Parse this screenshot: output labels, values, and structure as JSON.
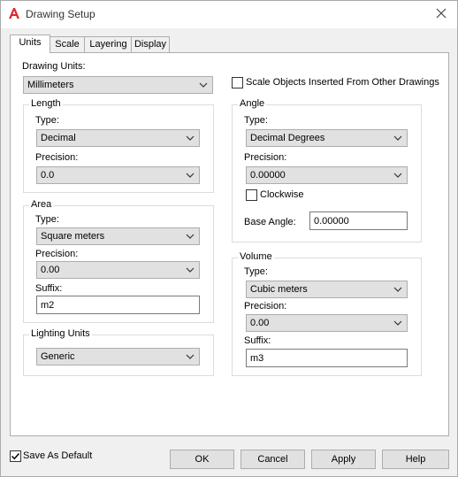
{
  "window": {
    "title": "Drawing Setup",
    "app_icon": "autocad-a-icon",
    "close_icon": "close-icon"
  },
  "tabs": [
    {
      "label": "Units",
      "active": true
    },
    {
      "label": "Scale",
      "active": false
    },
    {
      "label": "Layering",
      "active": false
    },
    {
      "label": "Display",
      "active": false
    }
  ],
  "units": {
    "drawing_units_label": "Drawing Units:",
    "drawing_units_value": "Millimeters",
    "scale_objects_label": "Scale Objects Inserted From Other Drawings",
    "scale_objects_checked": false,
    "length": {
      "title": "Length",
      "type_label": "Type:",
      "type_value": "Decimal",
      "precision_label": "Precision:",
      "precision_value": "0.0"
    },
    "area": {
      "title": "Area",
      "type_label": "Type:",
      "type_value": "Square meters",
      "precision_label": "Precision:",
      "precision_value": "0.00",
      "suffix_label": "Suffix:",
      "suffix_value": "m2"
    },
    "lighting": {
      "title": "Lighting Units",
      "value": "Generic"
    },
    "angle": {
      "title": "Angle",
      "type_label": "Type:",
      "type_value": "Decimal Degrees",
      "precision_label": "Precision:",
      "precision_value": "0.00000",
      "clockwise_label": "Clockwise",
      "clockwise_checked": false,
      "base_angle_label": "Base Angle:",
      "base_angle_value": "0.00000"
    },
    "volume": {
      "title": "Volume",
      "type_label": "Type:",
      "type_value": "Cubic meters",
      "precision_label": "Precision:",
      "precision_value": "0.00",
      "suffix_label": "Suffix:",
      "suffix_value": "m3"
    }
  },
  "footer": {
    "save_default_label": "Save As Default",
    "save_default_checked": true,
    "ok": "OK",
    "cancel": "Cancel",
    "apply": "Apply",
    "help": "Help"
  },
  "colors": {
    "brand_red": "#e0282e",
    "control_bg": "#e1e1e1",
    "border": "#adadad"
  }
}
